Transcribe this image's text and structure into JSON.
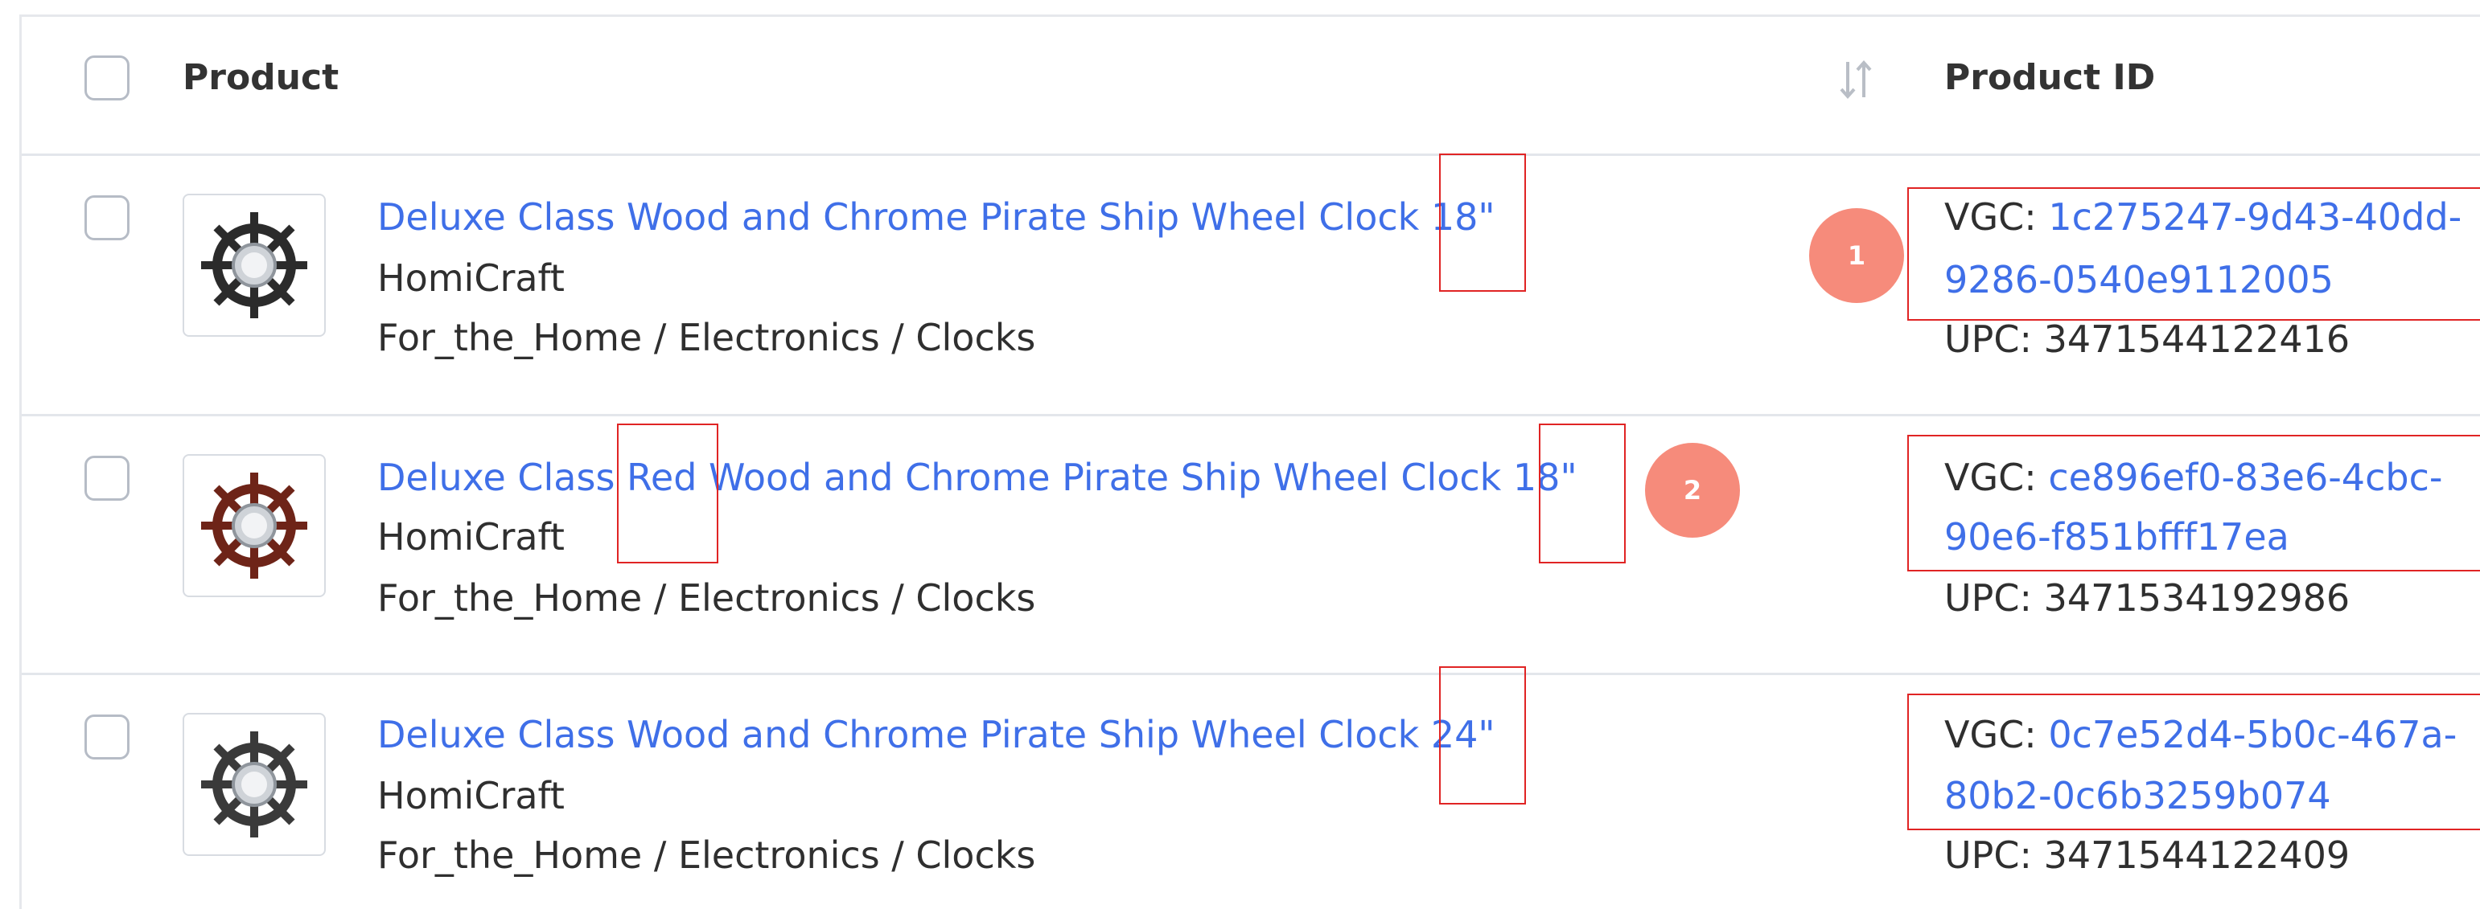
{
  "header": {
    "product_label": "Product",
    "product_id_label": "Product ID"
  },
  "rows": [
    {
      "title": "Deluxe Class Wood and Chrome Pirate Ship Wheel Clock 18\"",
      "brand": "HomiCraft",
      "category": "For_the_Home / Electronics / Clocks",
      "vgc_prefix": "VGC: ",
      "vgc_line1": "1c275247-9d43-40dd-",
      "vgc_line2": "9286-0540e9112005",
      "upc": "UPC: 3471544122416",
      "wheel_color": "#2b2b2b"
    },
    {
      "title": "Deluxe Class Red Wood and Chrome Pirate Ship Wheel Clock 18\"",
      "brand": "HomiCraft",
      "category": "For_the_Home / Electronics / Clocks",
      "vgc_prefix": "VGC: ",
      "vgc_line1": "ce896ef0-83e6-4cbc-",
      "vgc_line2": "90e6-f851bfff17ea",
      "upc": "UPC: 3471534192986",
      "wheel_color": "#6e2418"
    },
    {
      "title": "Deluxe Class Wood and Chrome Pirate Ship Wheel Clock 24\"",
      "brand": "HomiCraft",
      "category": "For_the_Home / Electronics / Clocks",
      "vgc_prefix": "VGC: ",
      "vgc_line1": "0c7e52d4-5b0c-467a-",
      "vgc_line2": "80b2-0c6b3259b074",
      "upc": "UPC: 3471544122409",
      "wheel_color": "#3a3a3a"
    }
  ],
  "badges": {
    "first": "1",
    "second": "2"
  },
  "colors": {
    "link": "#3f6fe8",
    "highlight": "#e02424",
    "badge": "#f68b7b"
  }
}
